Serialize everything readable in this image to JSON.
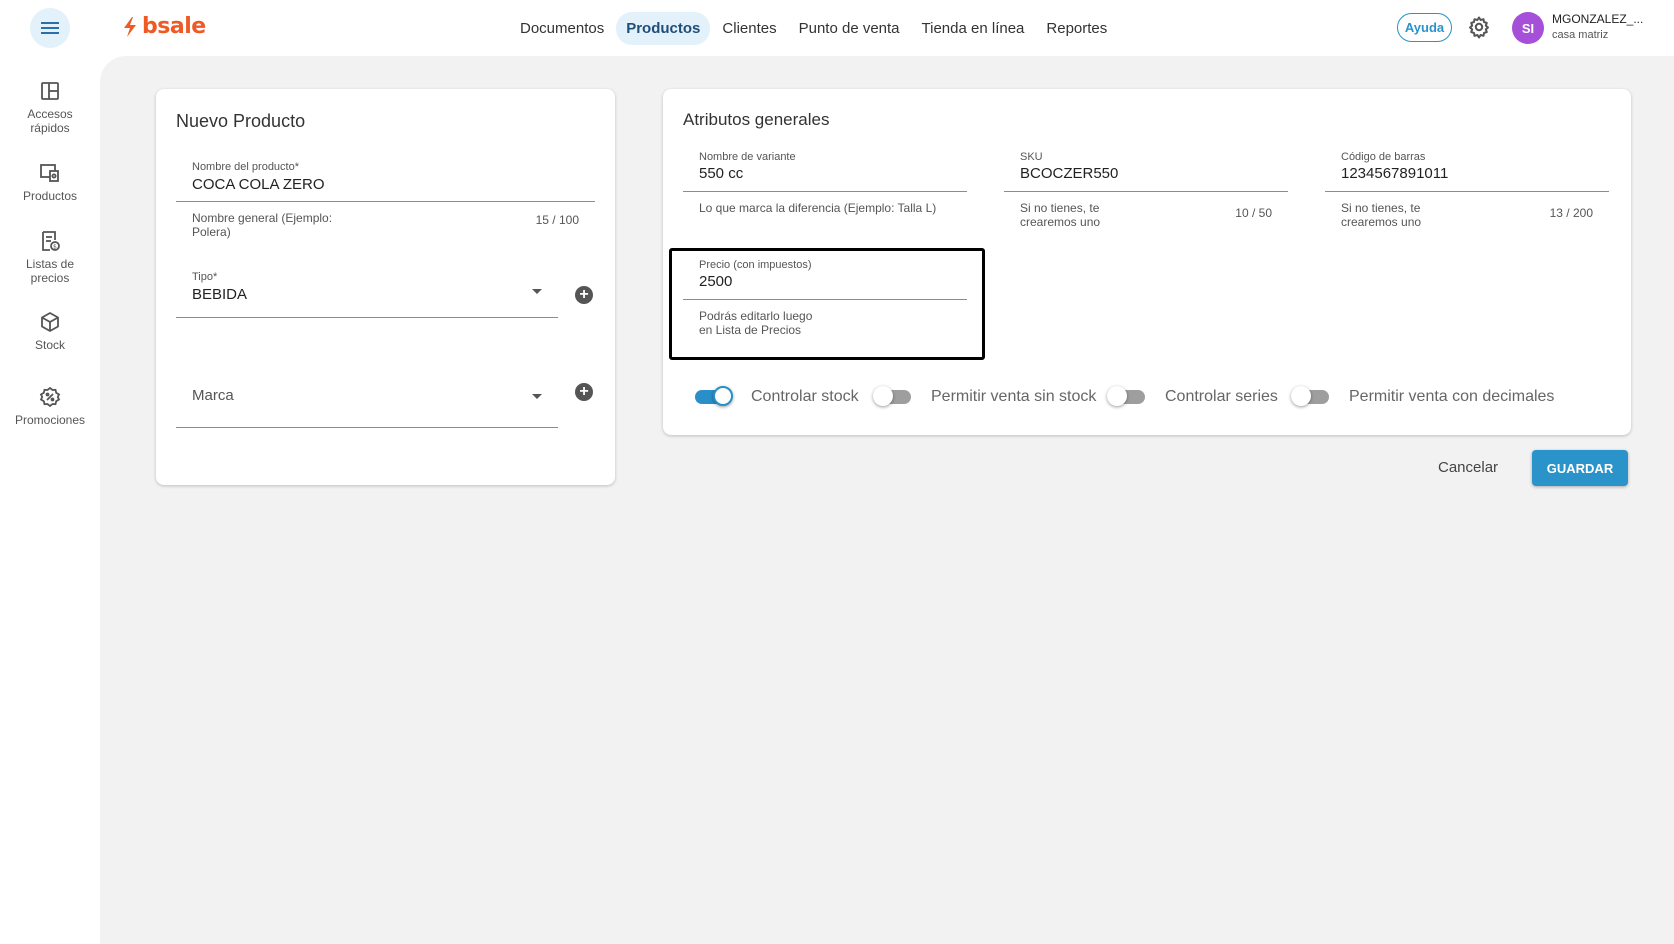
{
  "app": {
    "logo_text": "bsale",
    "brand_color": "#ef5a24",
    "accent_color": "#2a93c9"
  },
  "header": {
    "nav": [
      {
        "label": "Documentos"
      },
      {
        "label": "Productos"
      },
      {
        "label": "Clientes"
      },
      {
        "label": "Punto de venta"
      },
      {
        "label": "Tienda en línea"
      },
      {
        "label": "Reportes"
      }
    ],
    "active_nav": "Productos",
    "help_label": "Ayuda",
    "user": {
      "initials": "SI",
      "name": "MGONZALEZ_...",
      "branch": "casa matriz"
    }
  },
  "sidebar": {
    "items": [
      {
        "label": "Accesos rápidos",
        "icon": "layout-icon"
      },
      {
        "label": "Productos",
        "icon": "products-icon"
      },
      {
        "label": "Listas de precios",
        "icon": "price-list-icon"
      },
      {
        "label": "Stock",
        "icon": "box-icon"
      },
      {
        "label": "Promociones",
        "icon": "promo-icon"
      }
    ]
  },
  "new_product": {
    "title": "Nuevo Producto",
    "name_field": {
      "label": "Nombre del producto*",
      "value": "COCA COLA ZERO",
      "hint": "Nombre general (Ejemplo: Polera)",
      "counter": "15 / 100"
    },
    "type_field": {
      "label": "Tipo*",
      "value": "BEBIDA"
    },
    "brand_field": {
      "placeholder": "Marca"
    }
  },
  "attributes": {
    "title": "Atributos generales",
    "variant_field": {
      "label": "Nombre de variante",
      "value": "550 cc",
      "hint": "Lo que marca la diferencia (Ejemplo: Talla L)"
    },
    "sku_field": {
      "label": "SKU",
      "value": "BCOCZER550",
      "hint": "Si no tienes, te crearemos uno",
      "counter": "10 / 50"
    },
    "barcode_field": {
      "label": "Código de barras",
      "value": "1234567891011",
      "hint": "Si no tienes, te crearemos uno",
      "counter": "13 / 200"
    },
    "price_field": {
      "label": "Precio (con impuestos)",
      "value": "2500",
      "hint": "Podrás editarlo luego en Lista de Precios"
    },
    "toggles": [
      {
        "label": "Controlar stock",
        "on": true
      },
      {
        "label": "Permitir venta sin stock",
        "on": false
      },
      {
        "label": "Controlar series",
        "on": false
      },
      {
        "label": "Permitir venta con decimales",
        "on": false
      }
    ]
  },
  "actions": {
    "cancel_label": "Cancelar",
    "save_label": "GUARDAR"
  }
}
